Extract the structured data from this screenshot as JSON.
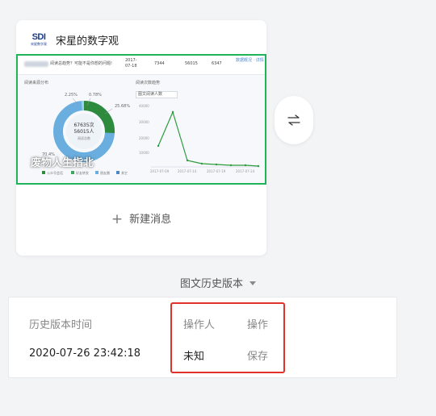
{
  "account": {
    "logo_text": "SDI",
    "logo_subtext": "宋星数字观",
    "name": "宋星的数字观"
  },
  "cover": {
    "question_text": "阅读总趋势？可能不是你想的问题!",
    "date": "2017-07-18",
    "stat_1": "7344",
    "stat_2": "56015",
    "stat_3": "6347",
    "link": "数据概况 · 详情",
    "left_panel_title": "阅读来源分布",
    "right_panel_title": "阅读次数趋势",
    "dropdown_value": "图文阅读人数",
    "donut_value_1": "67635次",
    "donut_value_2": "56015人",
    "donut_value_3": "阅读总数",
    "pct_1": "2.25%",
    "pct_2": "0.78%",
    "pct_3": "25.68%",
    "pct_4": "70.4%",
    "y_ticks": [
      "40000",
      "30000",
      "20000",
      "10000"
    ],
    "x_ticks": [
      "2017-07-09",
      "2017-07-14",
      "2017-07-19",
      "2017-07-24"
    ],
    "legend": [
      "公众号会话",
      "好友转发",
      "朋友圈",
      "其它"
    ],
    "watermark": "废物人生指北"
  },
  "new_message": {
    "label": "新建消息"
  },
  "history": {
    "toggle_label": "图文历史版本",
    "headers": {
      "time": "历史版本时间",
      "operator": "操作人",
      "action": "操作"
    },
    "row": {
      "time": "2020-07-26 23:42:18",
      "operator": "未知",
      "action": "保存"
    }
  },
  "colors": {
    "accent_green": "#20b35a",
    "highlight_red": "#e0312b"
  }
}
